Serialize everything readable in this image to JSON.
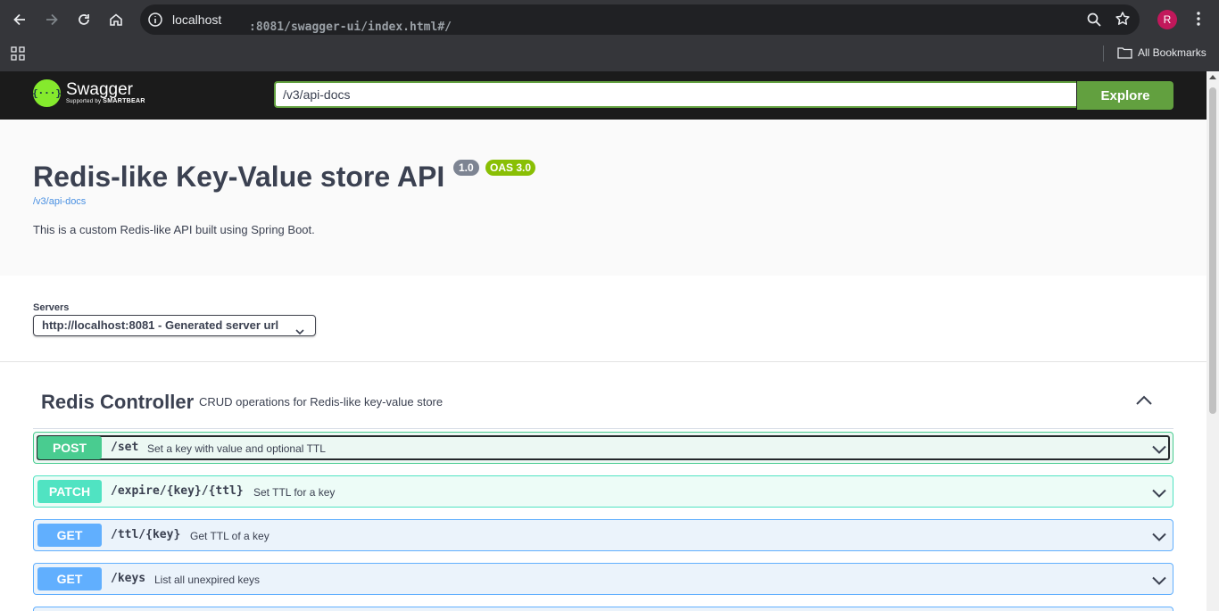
{
  "browser": {
    "url_host": "localhost",
    "url_rest": ":8081/swagger-ui/index.html#/",
    "avatar_initial": "R",
    "bookmarks_label": "All Bookmarks"
  },
  "swagger": {
    "logo_text": "Swagger",
    "logo_sub": "Supported by",
    "logo_sub_brand": "SMARTBEAR",
    "url_value": "/v3/api-docs",
    "explore_label": "Explore"
  },
  "info": {
    "title": "Redis-like Key-Value store API",
    "version": "1.0",
    "oas": "OAS 3.0",
    "spec_link": "/v3/api-docs",
    "description": "This is a custom Redis-like API built using Spring Boot."
  },
  "servers": {
    "label": "Servers",
    "selected": "http://localhost:8081 - Generated server url"
  },
  "tag": {
    "name": "Redis Controller",
    "description": "CRUD operations for Redis-like key-value store"
  },
  "operations": [
    {
      "method": "POST",
      "path": "/set",
      "summary": "Set a key with value and optional TTL"
    },
    {
      "method": "PATCH",
      "path": "/expire/{key}/{ttl}",
      "summary": "Set TTL for a key"
    },
    {
      "method": "GET",
      "path": "/ttl/{key}",
      "summary": "Get TTL of a key"
    },
    {
      "method": "GET",
      "path": "/keys",
      "summary": "List all unexpired keys"
    }
  ],
  "colors": {
    "post": "#49cc90",
    "patch": "#50e3c2",
    "get": "#61affe",
    "explore": "#62a03f"
  }
}
